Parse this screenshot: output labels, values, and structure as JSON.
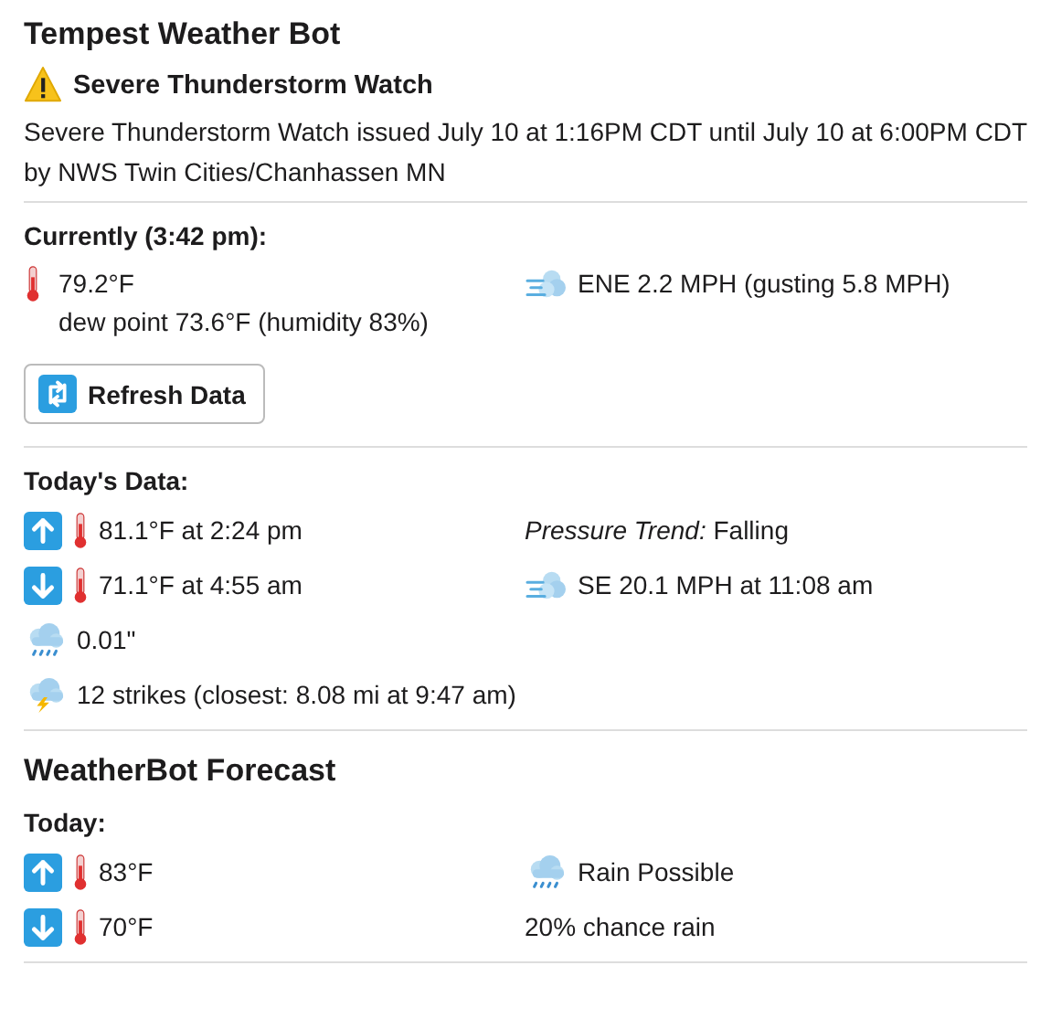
{
  "title": "Tempest Weather Bot",
  "alert": {
    "title": "Severe Thunderstorm Watch",
    "text": "Severe Thunderstorm Watch issued July 10 at 1:16PM CDT until July 10 at 6:00PM CDT by NWS Twin Cities/Chanhassen MN"
  },
  "current": {
    "label": "Currently (3:42 pm):",
    "temperature": "79.2°F",
    "dew_point": "dew point 73.6°F (humidity 83%)",
    "wind": "ENE 2.2 MPH (gusting 5.8 MPH)"
  },
  "refresh_button": "Refresh Data",
  "today_data": {
    "label": "Today's Data:",
    "rows": [
      {
        "left": {
          "kind": "high",
          "text": "81.1°F at 2:24 pm"
        },
        "right": {
          "kind": "text",
          "text": "*Pressure Trend:* Falling"
        }
      },
      {
        "left": {
          "kind": "low",
          "text": "71.1°F at 4:55 am"
        },
        "right": {
          "kind": "wind",
          "text": "SE 20.1 MPH at 11:08 am"
        }
      },
      {
        "left": {
          "kind": "rain",
          "text": "0.01\""
        }
      },
      {
        "left": {
          "kind": "lightning",
          "text": "12 strikes (closest: 8.08 mi at 9:47 am)"
        }
      }
    ]
  },
  "forecast": {
    "title": "WeatherBot Forecast",
    "label": "Today:",
    "rows": [
      {
        "left": {
          "kind": "high",
          "text": "83°F"
        },
        "right": {
          "kind": "rain",
          "text": "Rain Possible"
        }
      },
      {
        "left": {
          "kind": "low",
          "text": "70°F"
        },
        "right": {
          "kind": "text",
          "text": "20% chance rain"
        }
      }
    ]
  }
}
